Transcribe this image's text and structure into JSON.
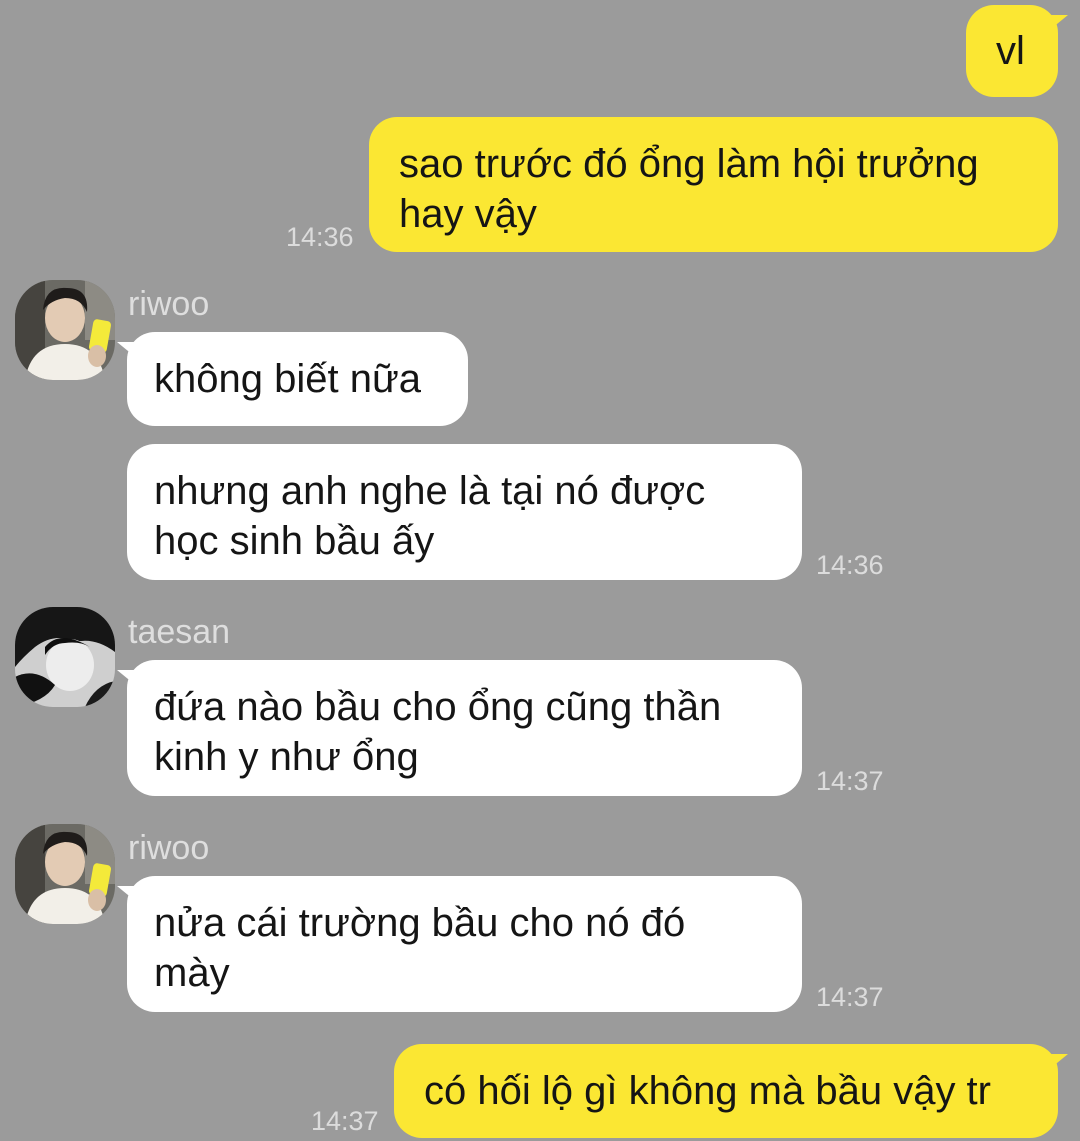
{
  "messages": [
    {
      "kind": "me",
      "text": "vl"
    },
    {
      "kind": "me",
      "lines": [
        "sao trước đó ổng làm hội trưởng",
        "hay vậy"
      ],
      "time": "14:36"
    },
    {
      "kind": "them",
      "sender": "riwoo",
      "avatar_icon": "riwoo-avatar-icon",
      "text": "không biết nữa"
    },
    {
      "kind": "them",
      "lines": [
        "nhưng anh nghe là tại nó được",
        "học sinh bầu ấy"
      ],
      "time": "14:36"
    },
    {
      "kind": "them",
      "sender": "taesan",
      "avatar_icon": "taesan-avatar-icon",
      "lines": [
        "đứa nào bầu cho ổng cũng thần",
        "kinh y như ổng"
      ],
      "time": "14:37"
    },
    {
      "kind": "them",
      "sender": "riwoo",
      "avatar_icon": "riwoo-avatar-icon",
      "lines": [
        "nửa cái trường bầu cho nó đó",
        "mày"
      ],
      "time": "14:37"
    },
    {
      "kind": "me",
      "text": "có hối lộ gì không mà bầu vậy tr",
      "time": "14:37"
    }
  ],
  "colors": {
    "background": "#9b9b9b",
    "my_bubble": "#fbe733",
    "their_bubble": "#ffffff",
    "timestamp": "#dcdcdc",
    "sender_name": "#dedede"
  }
}
